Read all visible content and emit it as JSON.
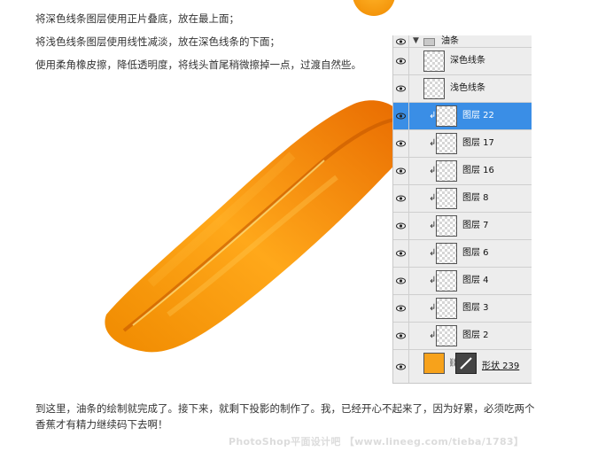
{
  "instructions": [
    "将深色线条图层使用正片叠底，放在最上面；",
    "将浅色线条图层使用线性减淡，放在深色线条的下面；",
    "使用柔角橡皮擦，降低透明度，将线头首尾稍微擦掉一点，过渡自然些。"
  ],
  "layers_panel": {
    "group_name": "油条",
    "layers": [
      {
        "name": "深色线条",
        "clipped": false,
        "selected": false
      },
      {
        "name": "浅色线条",
        "clipped": false,
        "selected": false
      },
      {
        "name": "图层 22",
        "clipped": true,
        "selected": true
      },
      {
        "name": "图层 17",
        "clipped": true,
        "selected": false
      },
      {
        "name": "图层 16",
        "clipped": true,
        "selected": false
      },
      {
        "name": "图层 8",
        "clipped": true,
        "selected": false
      },
      {
        "name": "图层 7",
        "clipped": true,
        "selected": false
      },
      {
        "name": "图层 6",
        "clipped": true,
        "selected": false
      },
      {
        "name": "图层 4",
        "clipped": true,
        "selected": false
      },
      {
        "name": "图层 3",
        "clipped": true,
        "selected": false
      },
      {
        "name": "图层 2",
        "clipped": true,
        "selected": false
      }
    ],
    "shape_layer_name": "形状 239",
    "shape_color": "#f7a21b",
    "selected_color": "#3a8ee6"
  },
  "bottom_text": [
    "到这里，油条的绘制就完成了。接下来，就剩下投影的制作了。我，已经开心不起来了，因为好累，必须吃两个",
    "香蕉才有精力继续码下去啊！"
  ],
  "watermark": "PhotoShop平面设计吧 【www.lineeg.com/tieba/1783】"
}
